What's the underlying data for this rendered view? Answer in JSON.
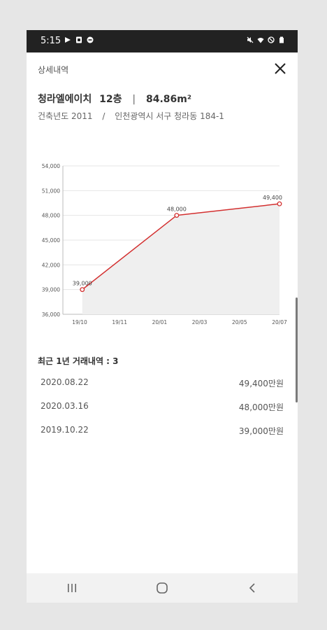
{
  "status_bar": {
    "time": "5:15",
    "left_icons": [
      "play-icon",
      "sim-icon",
      "notification-icon"
    ],
    "right_icons": [
      "mute-icon",
      "wifi-icon",
      "dnd-icon",
      "battery-icon"
    ]
  },
  "header": {
    "title": "상세내역",
    "close_icon": "close-icon"
  },
  "apartment": {
    "name": "청라엘에이치",
    "floor": "12층",
    "separator": "|",
    "area": "84.86m²",
    "built_label": "건축년도 2011",
    "address_separator": "/",
    "address": "인천광역시 서구 청라동 184-1"
  },
  "chart_data": {
    "type": "line",
    "x": [
      "2019-10-22",
      "2020-03-16",
      "2020-08-22"
    ],
    "series": [
      {
        "values": [
          39000,
          48000,
          49400
        ]
      }
    ],
    "data_labels": [
      "39,000",
      "48,000",
      "49,400"
    ],
    "x_tick_labels": [
      "19/10",
      "19/11",
      "20/01",
      "20/03",
      "20/05",
      "20/07"
    ],
    "y_tick_labels": [
      "36,000",
      "39,000",
      "42,000",
      "45,000",
      "48,000",
      "51,000",
      "54,000"
    ],
    "y_ticks": [
      36000,
      39000,
      42000,
      45000,
      48000,
      51000,
      54000
    ],
    "ylim": [
      36000,
      54000
    ],
    "xlim": [
      "2019-09-22",
      "2020-08-22"
    ],
    "grid": true,
    "line_color": "#d32f2f",
    "fill_color": "#efefef"
  },
  "history": {
    "title": "최근 1년 거래내역 : 3",
    "rows": [
      {
        "date": "2020.08.22",
        "price": "49,400만원"
      },
      {
        "date": "2020.03.16",
        "price": "48,000만원"
      },
      {
        "date": "2019.10.22",
        "price": "39,000만원"
      }
    ]
  },
  "navbar": {
    "buttons": [
      "recents-icon",
      "home-icon",
      "back-icon"
    ]
  }
}
